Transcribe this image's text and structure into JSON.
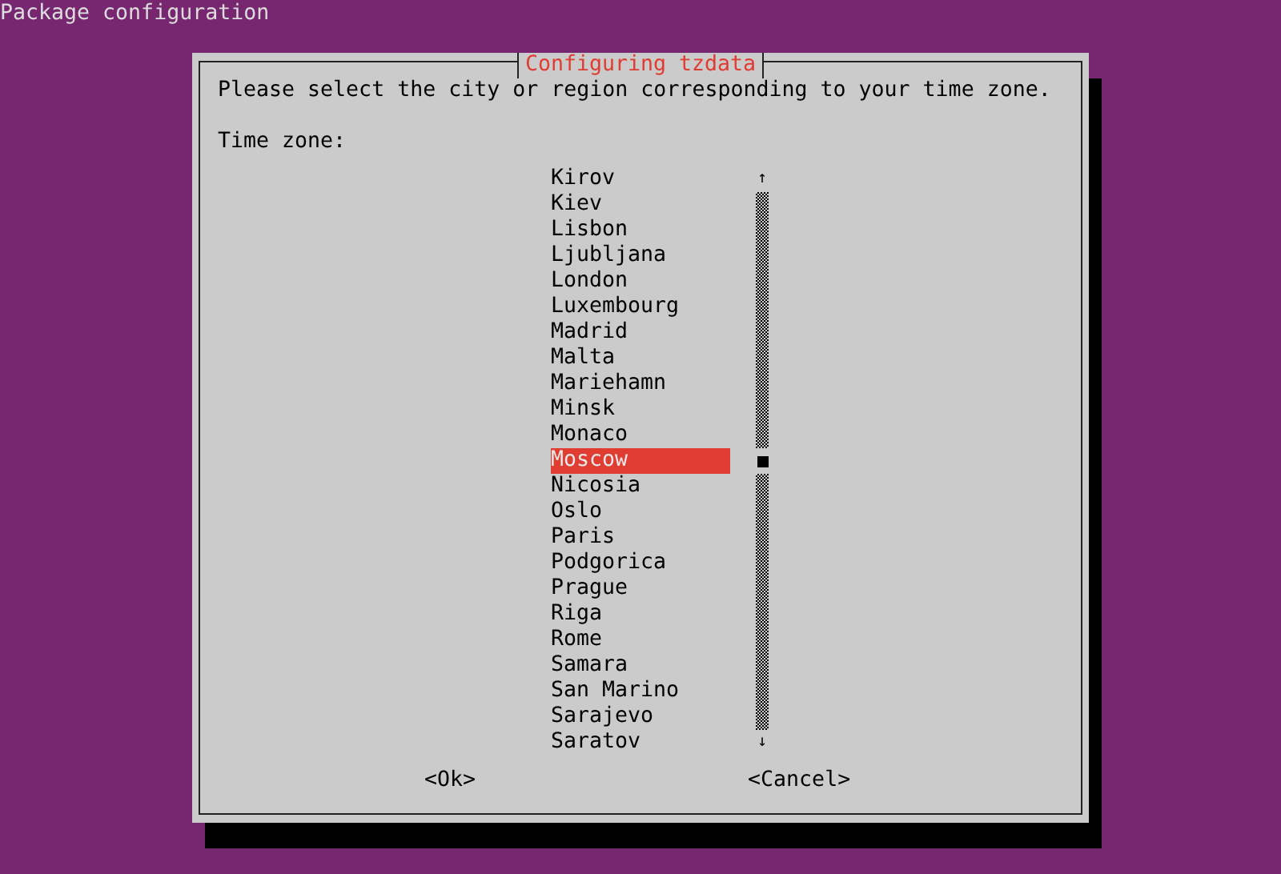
{
  "header": "Package configuration",
  "dialog": {
    "title": "Configuring tzdata",
    "prompt": "Please select the city or region corresponding to your time zone.",
    "label": "Time zone:",
    "items": [
      {
        "label": "Kirov",
        "selected": false
      },
      {
        "label": "Kiev",
        "selected": false
      },
      {
        "label": "Lisbon",
        "selected": false
      },
      {
        "label": "Ljubljana",
        "selected": false
      },
      {
        "label": "London",
        "selected": false
      },
      {
        "label": "Luxembourg",
        "selected": false
      },
      {
        "label": "Madrid",
        "selected": false
      },
      {
        "label": "Malta",
        "selected": false
      },
      {
        "label": "Mariehamn",
        "selected": false
      },
      {
        "label": "Minsk",
        "selected": false
      },
      {
        "label": "Monaco",
        "selected": false
      },
      {
        "label": "Moscow",
        "selected": true
      },
      {
        "label": "Nicosia",
        "selected": false
      },
      {
        "label": "Oslo",
        "selected": false
      },
      {
        "label": "Paris",
        "selected": false
      },
      {
        "label": "Podgorica",
        "selected": false
      },
      {
        "label": "Prague",
        "selected": false
      },
      {
        "label": "Riga",
        "selected": false
      },
      {
        "label": "Rome",
        "selected": false
      },
      {
        "label": "Samara",
        "selected": false
      },
      {
        "label": "San Marino",
        "selected": false
      },
      {
        "label": "Sarajevo",
        "selected": false
      },
      {
        "label": "Saratov",
        "selected": false
      }
    ],
    "scrollbar": {
      "up": "↑",
      "down": "↓"
    },
    "buttons": [
      "<Ok>",
      "<Cancel>"
    ]
  }
}
